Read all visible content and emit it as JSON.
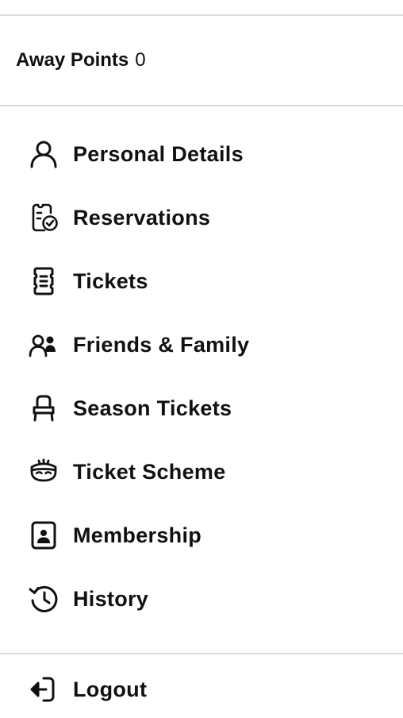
{
  "points": {
    "label": "Away Points",
    "value": "0"
  },
  "menu": {
    "items": [
      {
        "label": "Personal Details",
        "icon": "person-icon"
      },
      {
        "label": "Reservations",
        "icon": "clipboard-check-icon"
      },
      {
        "label": "Tickets",
        "icon": "ticket-icon"
      },
      {
        "label": "Friends & Family",
        "icon": "users-icon"
      },
      {
        "label": "Season Tickets",
        "icon": "seat-icon"
      },
      {
        "label": "Ticket Scheme",
        "icon": "mask-icon"
      },
      {
        "label": "Membership",
        "icon": "id-card-icon"
      },
      {
        "label": "History",
        "icon": "history-icon"
      }
    ],
    "logout": {
      "label": "Logout",
      "icon": "logout-icon"
    }
  }
}
